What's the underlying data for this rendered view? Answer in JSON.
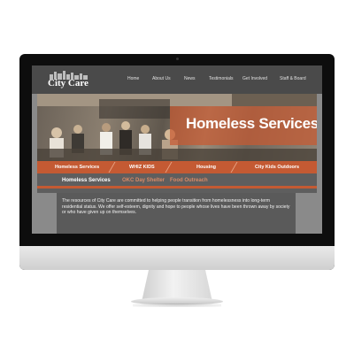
{
  "site": {
    "logo_text": "City Care",
    "nav": [
      "Home",
      "About Us",
      "News",
      "Testimonials",
      "Get Involved",
      "Staff & Board"
    ]
  },
  "hero": {
    "title": "Homeless Services"
  },
  "tabs": [
    "Homeless Services",
    "WHIZ KIDS",
    "Housing",
    "City Kids Outdoors"
  ],
  "subnav": {
    "items": [
      "Homeless Services",
      "OKC Day Shelter",
      "Food Outreach"
    ],
    "active_index": 0
  },
  "content": {
    "paragraph": "The resources of City Care are committed to helping people transition from homelessness into long-term residential status. We offer self-esteem, dignity and hope to people whose lives have been thrown away by society or who have given up on themselves."
  },
  "colors": {
    "accent": "#c45a33",
    "active_subnav": "#ffffff",
    "inactive_subnav": "#d98a66"
  }
}
